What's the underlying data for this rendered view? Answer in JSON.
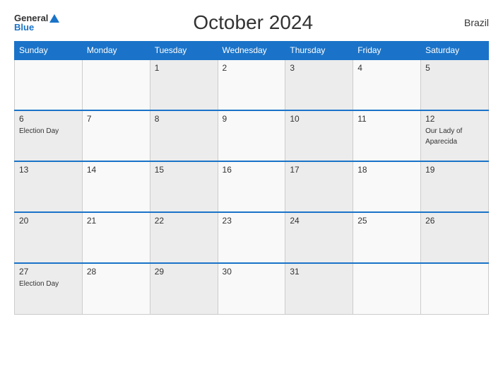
{
  "header": {
    "logo_general": "General",
    "logo_blue": "Blue",
    "title": "October 2024",
    "country": "Brazil"
  },
  "calendar": {
    "days_of_week": [
      "Sunday",
      "Monday",
      "Tuesday",
      "Wednesday",
      "Thursday",
      "Friday",
      "Saturday"
    ],
    "weeks": [
      [
        {
          "date": "",
          "event": ""
        },
        {
          "date": "",
          "event": ""
        },
        {
          "date": "1",
          "event": ""
        },
        {
          "date": "2",
          "event": ""
        },
        {
          "date": "3",
          "event": ""
        },
        {
          "date": "4",
          "event": ""
        },
        {
          "date": "5",
          "event": ""
        }
      ],
      [
        {
          "date": "6",
          "event": "Election Day"
        },
        {
          "date": "7",
          "event": ""
        },
        {
          "date": "8",
          "event": ""
        },
        {
          "date": "9",
          "event": ""
        },
        {
          "date": "10",
          "event": ""
        },
        {
          "date": "11",
          "event": ""
        },
        {
          "date": "12",
          "event": "Our Lady of Aparecida"
        }
      ],
      [
        {
          "date": "13",
          "event": ""
        },
        {
          "date": "14",
          "event": ""
        },
        {
          "date": "15",
          "event": ""
        },
        {
          "date": "16",
          "event": ""
        },
        {
          "date": "17",
          "event": ""
        },
        {
          "date": "18",
          "event": ""
        },
        {
          "date": "19",
          "event": ""
        }
      ],
      [
        {
          "date": "20",
          "event": ""
        },
        {
          "date": "21",
          "event": ""
        },
        {
          "date": "22",
          "event": ""
        },
        {
          "date": "23",
          "event": ""
        },
        {
          "date": "24",
          "event": ""
        },
        {
          "date": "25",
          "event": ""
        },
        {
          "date": "26",
          "event": ""
        }
      ],
      [
        {
          "date": "27",
          "event": "Election Day"
        },
        {
          "date": "28",
          "event": ""
        },
        {
          "date": "29",
          "event": ""
        },
        {
          "date": "30",
          "event": ""
        },
        {
          "date": "31",
          "event": ""
        },
        {
          "date": "",
          "event": ""
        },
        {
          "date": "",
          "event": ""
        }
      ]
    ]
  }
}
